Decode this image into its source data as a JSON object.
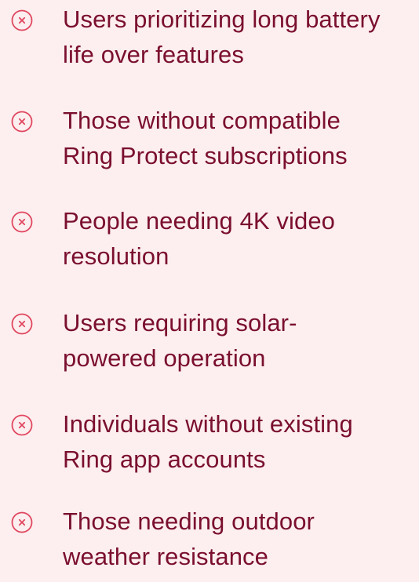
{
  "colors": {
    "background": "#FDEEEF",
    "text": "#7A0F2E",
    "icon": "#E0475F"
  },
  "icon_name": "close-circle-icon",
  "items": [
    {
      "lines": [
        "Users prioritizing long battery",
        "life over features"
      ]
    },
    {
      "lines": [
        "Those without compatible",
        "Ring Protect subscriptions"
      ]
    },
    {
      "lines": [
        "People needing 4K video",
        "resolution"
      ]
    },
    {
      "lines": [
        "Users requiring solar-",
        "powered operation"
      ]
    },
    {
      "lines": [
        "Individuals without existing",
        "Ring app accounts"
      ]
    },
    {
      "lines": [
        "Those needing outdoor",
        "weather resistance"
      ]
    }
  ]
}
